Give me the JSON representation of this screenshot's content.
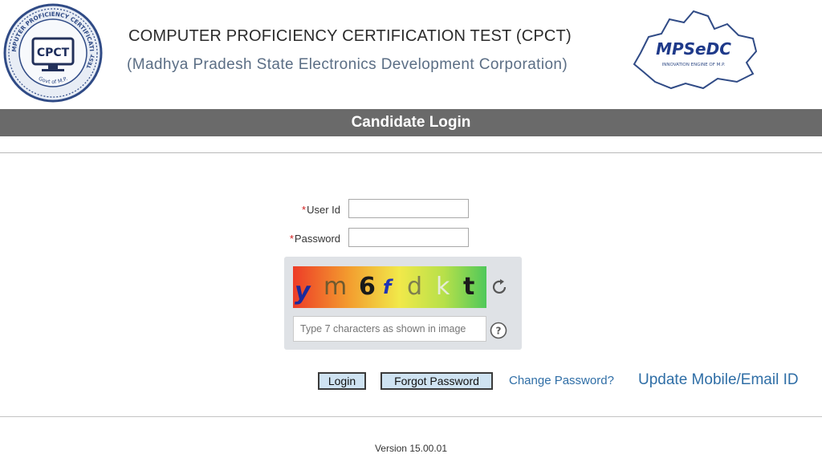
{
  "header": {
    "title": "COMPUTER PROFICIENCY CERTIFICATION TEST (CPCT)",
    "subtitle": "(Madhya Pradesh State Electronics Development Corporation)",
    "left_logo": {
      "name": "cpct-seal",
      "text_center": "CPCT",
      "ring_text_top": "COMPUTER PROFICIENCY CERTIFICATION",
      "ring_text_right": "TEST",
      "ring_text_bottom": "Govt of M.P."
    },
    "right_logo": {
      "name": "mpsedc-logo",
      "text": "MPSeDC",
      "tagline": "INNOVATION ENGINE OF M.P."
    }
  },
  "banner": {
    "title": "Candidate Login"
  },
  "form": {
    "required_mark": "*",
    "user_id_label": "User Id",
    "user_id_value": "",
    "password_label": "Password",
    "password_value": "",
    "captcha": {
      "characters": [
        "y",
        "m",
        "6",
        "f",
        "d",
        "k",
        "t"
      ],
      "input_placeholder": "Type 7 characters as shown in image",
      "input_value": ""
    }
  },
  "actions": {
    "login": "Login",
    "forgot_password": "Forgot Password",
    "change_password": "Change Password?",
    "update_contact": "Update Mobile/Email ID"
  },
  "footer": {
    "version": "Version 15.00.01"
  },
  "colors": {
    "banner_bg": "#6a6a6a",
    "link": "#2f6ea6",
    "required": "#d21c1c",
    "button_bg": "#cfe3f2",
    "captcha_panel": "#dfe2e6"
  },
  "icons": [
    "cpct-seal",
    "mpsedc-logo",
    "refresh-icon",
    "help-icon"
  ]
}
